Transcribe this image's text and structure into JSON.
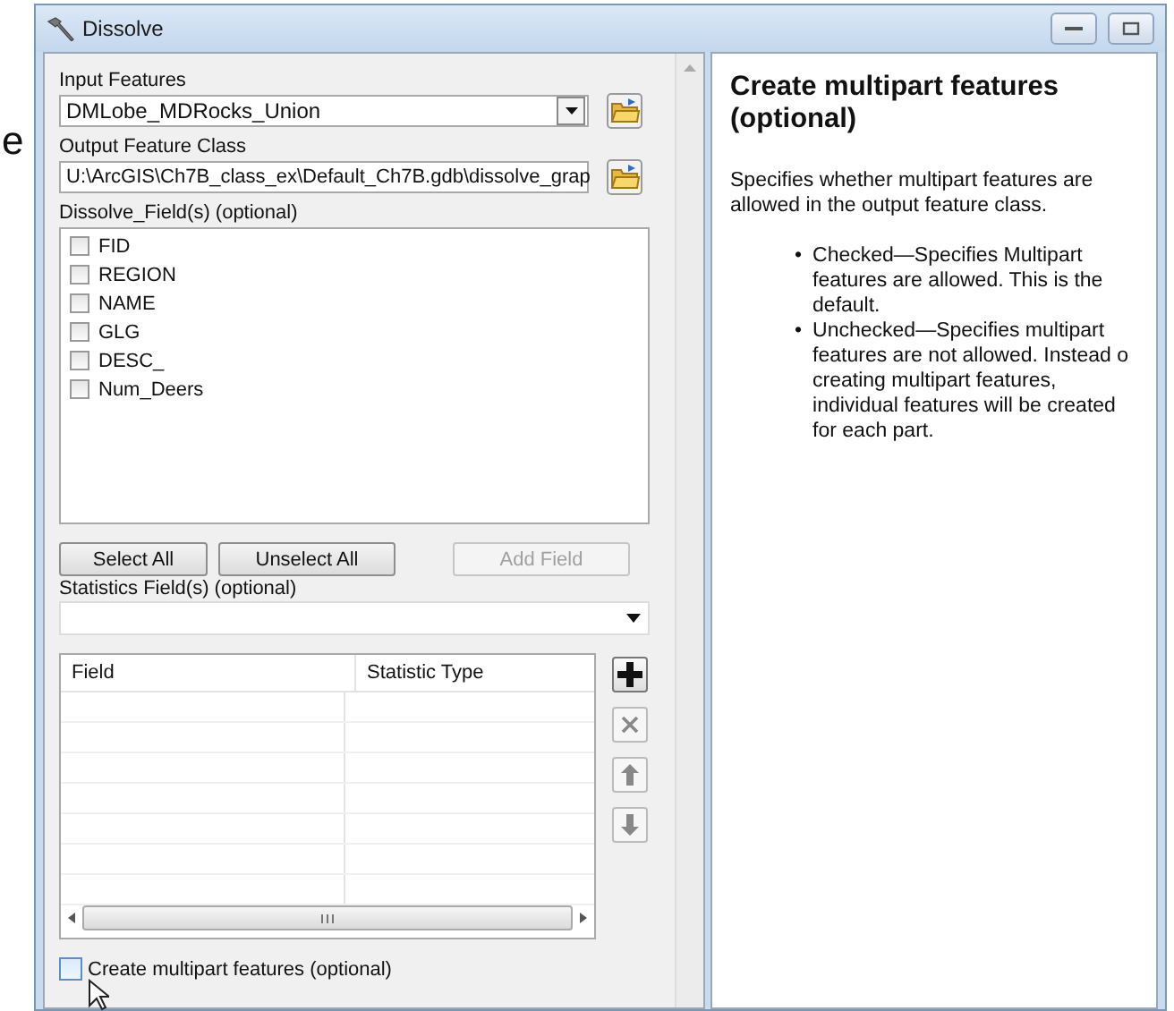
{
  "background_text": "e",
  "window": {
    "title": "Dissolve"
  },
  "input_features": {
    "label": "Input Features",
    "value": "DMLobe_MDRocks_Union"
  },
  "output_feature_class": {
    "label": "Output Feature Class",
    "value": "U:\\ArcGIS\\Ch7B_class_ex\\Default_Ch7B.gdb\\dissolve_grap"
  },
  "dissolve_fields": {
    "label": "Dissolve_Field(s) (optional)",
    "items": [
      {
        "label": "FID",
        "checked": false
      },
      {
        "label": "REGION",
        "checked": false
      },
      {
        "label": "NAME",
        "checked": false
      },
      {
        "label": "GLG",
        "checked": false
      },
      {
        "label": "DESC_",
        "checked": false
      },
      {
        "label": "Num_Deers",
        "checked": false
      }
    ]
  },
  "buttons": [
    {
      "label": "Select All",
      "disabled": false
    },
    {
      "label": "Unselect All",
      "disabled": false
    },
    {
      "label": "Add Field",
      "disabled": true
    }
  ],
  "statistics_fields": {
    "label": "Statistics Field(s) (optional)",
    "columns": [
      "Field",
      "Statistic Type"
    ]
  },
  "multipart": {
    "label": "Create multipart features (optional)",
    "checked": false
  },
  "help": {
    "title": "Create multipart features (optional)",
    "description": "Specifies whether multipart features are allowed in the output feature class.",
    "bullets": [
      {
        "marker": "•",
        "lines": [
          "Checked—Specifies Multipart",
          "features are allowed. This is the",
          "default."
        ]
      },
      {
        "marker": "•",
        "lines": [
          "Unchecked—Specifies multipart",
          "features are not allowed. Instead o",
          "creating multipart features,",
          "individual features will be created",
          "for each part."
        ]
      }
    ]
  }
}
